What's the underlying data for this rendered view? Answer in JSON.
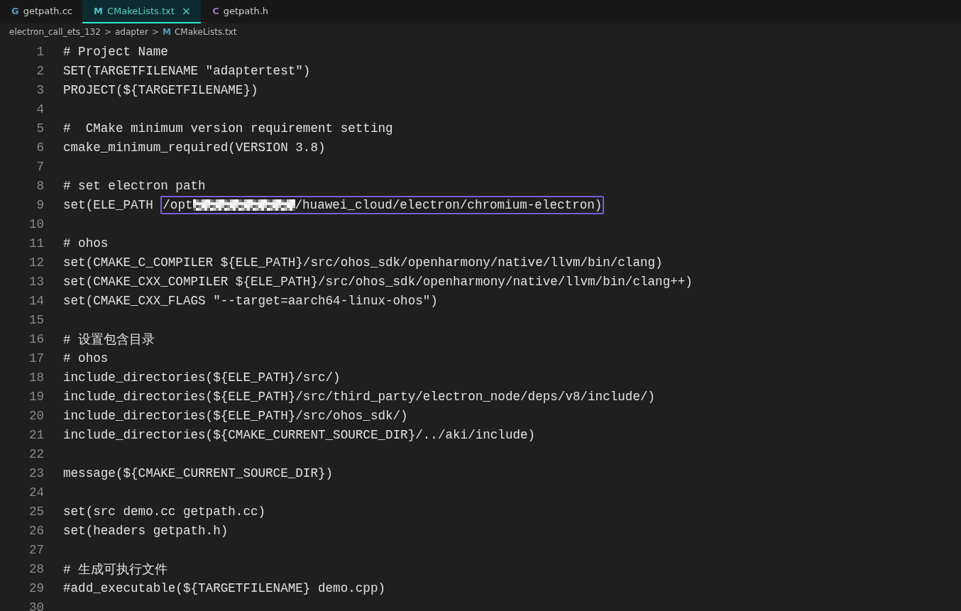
{
  "tabs": [
    {
      "icon": "G",
      "color": "#519aba",
      "label": "getpath.cc",
      "selected": false,
      "closable": false
    },
    {
      "icon": "M",
      "color": "#4fc1c9",
      "label": "CMakeLists.txt",
      "selected": true,
      "closable": true,
      "close_glyph": "×"
    },
    {
      "icon": "C",
      "color": "#a074c4",
      "label": "getpath.h",
      "selected": false,
      "closable": false
    }
  ],
  "breadcrumb": {
    "segments": [
      "electron_call_ets_132",
      "adapter"
    ],
    "separator": ">",
    "file_icon": "M",
    "file": "CMakeLists.txt"
  },
  "lines": [
    {
      "number": "1",
      "text": "# Project Name"
    },
    {
      "number": "2",
      "text": "SET(TARGETFILENAME \"adaptertest\")"
    },
    {
      "number": "3",
      "text": "PROJECT(${TARGETFILENAME})"
    },
    {
      "number": "4"
    },
    {
      "number": "5",
      "text": "#  CMake minimum version requirement setting"
    },
    {
      "number": "6",
      "text": "cmake_minimum_required(VERSION 3.8)"
    },
    {
      "number": "7"
    },
    {
      "number": "8",
      "text": "# set electron path"
    },
    {
      "number": "9",
      "kind": "highlighted",
      "before": "set(ELE_PATH ",
      "boxed_start": "/opt",
      "redacted": true,
      "boxed_end": "/huawei_cloud/electron/chromium-electron)"
    },
    {
      "number": "10"
    },
    {
      "number": "11",
      "text": "# ohos"
    },
    {
      "number": "12",
      "text": "set(CMAKE_C_COMPILER ${ELE_PATH}/src/ohos_sdk/openharmony/native/llvm/bin/clang)"
    },
    {
      "number": "13",
      "text": "set(CMAKE_CXX_COMPILER ${ELE_PATH}/src/ohos_sdk/openharmony/native/llvm/bin/clang++)"
    },
    {
      "number": "14",
      "text": "set(CMAKE_CXX_FLAGS \"--target=aarch64-linux-ohos\")"
    },
    {
      "number": "15"
    },
    {
      "number": "16",
      "text": "# 设置包含目录"
    },
    {
      "number": "17",
      "text": "# ohos"
    },
    {
      "number": "18",
      "text": "include_directories(${ELE_PATH}/src/)"
    },
    {
      "number": "19",
      "text": "include_directories(${ELE_PATH}/src/third_party/electron_node/deps/v8/include/)"
    },
    {
      "number": "20",
      "text": "include_directories(${ELE_PATH}/src/ohos_sdk/)"
    },
    {
      "number": "21",
      "text": "include_directories(${CMAKE_CURRENT_SOURCE_DIR}/../aki/include)"
    },
    {
      "number": "22"
    },
    {
      "number": "23",
      "text": "message(${CMAKE_CURRENT_SOURCE_DIR})"
    },
    {
      "number": "24"
    },
    {
      "number": "25",
      "text": "set(src demo.cc getpath.cc)"
    },
    {
      "number": "26",
      "text": "set(headers getpath.h)"
    },
    {
      "number": "27"
    },
    {
      "number": "28",
      "text": "# 生成可执行文件"
    },
    {
      "number": "29",
      "text": "#add_executable(${TARGETFILENAME} demo.cpp)"
    },
    {
      "number": "30"
    }
  ]
}
